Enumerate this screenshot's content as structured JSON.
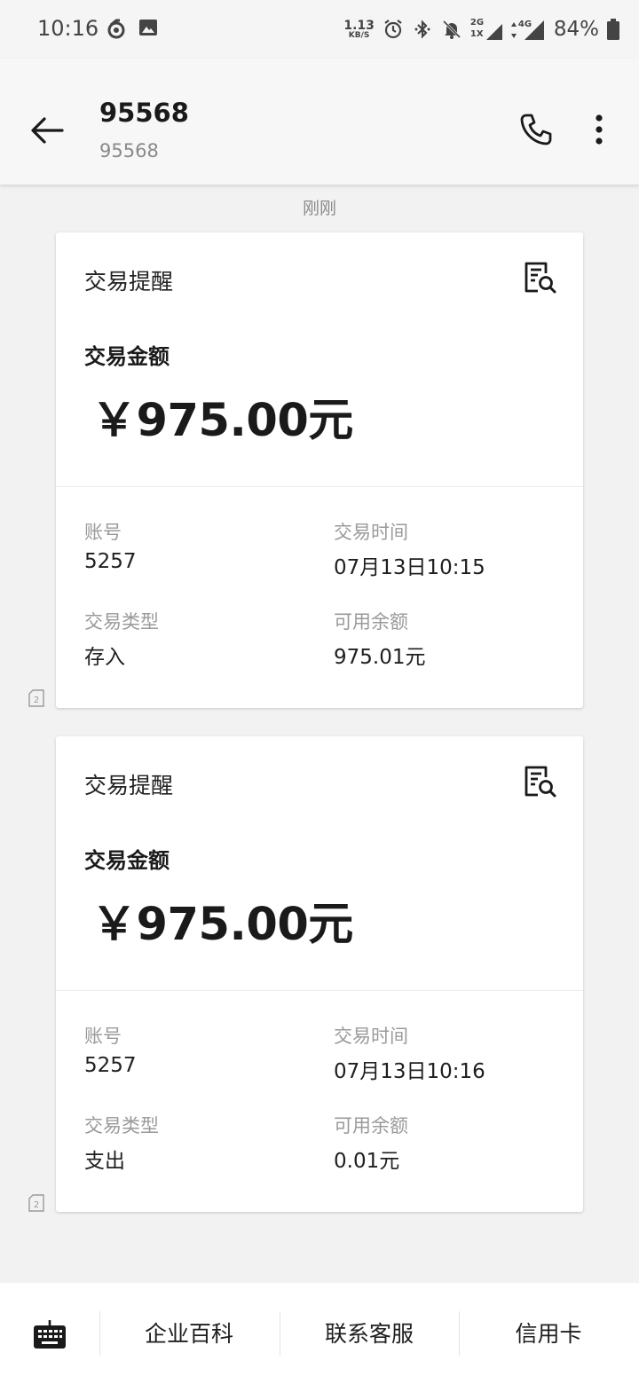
{
  "status_bar": {
    "time": "10:16",
    "net_speed_value": "1.13",
    "net_speed_unit": "KB/S",
    "signal_1_top": "2G",
    "signal_1_bottom": "1X",
    "signal_2": "4G",
    "battery": "84%"
  },
  "header": {
    "title": "95568",
    "subtitle": "95568"
  },
  "timestamp": "刚刚",
  "messages": [
    {
      "header": "交易提醒",
      "amount_label": "交易金额",
      "amount": "￥975.00元",
      "account_label": "账号",
      "account": "5257",
      "time_label": "交易时间",
      "time": "07月13日10:15",
      "type_label": "交易类型",
      "type": "存入",
      "balance_label": "可用余额",
      "balance": "975.01元",
      "sim_slot": "2"
    },
    {
      "header": "交易提醒",
      "amount_label": "交易金额",
      "amount": "￥975.00元",
      "account_label": "账号",
      "account": "5257",
      "time_label": "交易时间",
      "time": "07月13日10:16",
      "type_label": "交易类型",
      "type": "支出",
      "balance_label": "可用余额",
      "balance": "0.01元",
      "sim_slot": "2"
    }
  ],
  "bottom_menu": {
    "items": [
      "企业百科",
      "联系客服",
      "信用卡"
    ]
  },
  "icons": {
    "back": "arrow-left-icon",
    "call": "phone-icon",
    "more": "more-vertical-icon",
    "detail": "document-search-icon",
    "keyboard": "keyboard-icon",
    "sim": "sim-card-icon"
  }
}
